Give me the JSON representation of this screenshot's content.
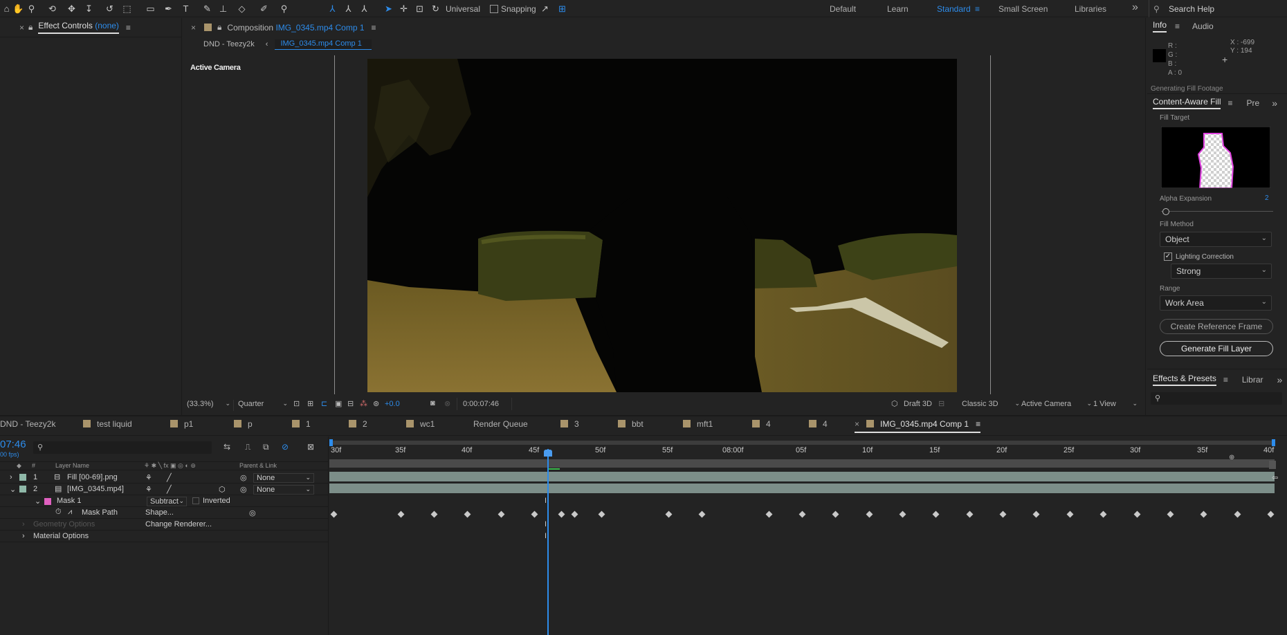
{
  "workspace": {
    "items": [
      "Default",
      "Learn",
      "Standard",
      "Small Screen",
      "Libraries"
    ],
    "active": "Standard",
    "search_placeholder": "Search Help",
    "more": "»"
  },
  "toolbar": {
    "universal": "Universal",
    "snapping": "Snapping"
  },
  "effect_controls": {
    "title": "Effect Controls",
    "value": "(none)"
  },
  "composition": {
    "title_prefix": "Composition",
    "title_name": "IMG_0345.mp4 Comp 1",
    "breadcrumb_root": "DND - Teezy2k",
    "breadcrumb_current": "IMG_0345.mp4 Comp 1",
    "camera_label": "Active Camera"
  },
  "viewer_bar": {
    "zoom": "(33.3%)",
    "resolution": "Quarter",
    "exposure": "+0.0",
    "timecode": "0:00:07:46",
    "renderer_draft": "Draft 3D",
    "renderer": "Classic 3D",
    "camera": "Active Camera",
    "views": "1 View"
  },
  "info": {
    "tab_info": "Info",
    "tab_audio": "Audio",
    "r": "R :",
    "g": "G :",
    "b": "B :",
    "a": "A :  0",
    "x": "X : -699",
    "y": "Y : 194",
    "status": "Generating Fill Footage"
  },
  "caf": {
    "tab": "Content-Aware Fill",
    "tab2": "Pre",
    "fill_target": "Fill Target",
    "alpha_expansion": "Alpha Expansion",
    "alpha_value": "2",
    "fill_method": "Fill Method",
    "fill_method_value": "Object",
    "lighting": "Lighting Correction",
    "lighting_value": "Strong",
    "range": "Range",
    "range_value": "Work Area",
    "create_ref": "Create Reference Frame",
    "generate": "Generate Fill Layer"
  },
  "effects": {
    "tab": "Effects & Presets",
    "tab2": "Librar"
  },
  "timeline_tabs": [
    "DND - Teezy2k",
    "test liquid",
    "p1",
    "p",
    "1",
    "2",
    "wc1",
    "Render Queue",
    "3",
    "bbt",
    "mft1",
    "4",
    "4",
    "IMG_0345.mp4 Comp 1"
  ],
  "timeline": {
    "timecode": "07:46",
    "fps": "00 fps)",
    "col_hash": "#",
    "col_layer": "Layer Name",
    "col_parent": "Parent & Link",
    "ruler": [
      "30f",
      "35f",
      "40f",
      "45f",
      "50f",
      "55f",
      "08:00f",
      "05f",
      "10f",
      "15f",
      "20f",
      "25f",
      "30f",
      "35f",
      "40f"
    ],
    "layers": [
      {
        "num": "1",
        "name": "Fill [00-69].png",
        "parent": "None"
      },
      {
        "num": "2",
        "name": "[IMG_0345.mp4]",
        "parent": "None"
      }
    ],
    "mask": "Mask 1",
    "mask_mode": "Subtract",
    "inverted": "Inverted",
    "mask_path": "Mask Path",
    "shape": "Shape...",
    "geometry": "Geometry Options",
    "renderer": "Change Renderer...",
    "material": "Material Options"
  }
}
